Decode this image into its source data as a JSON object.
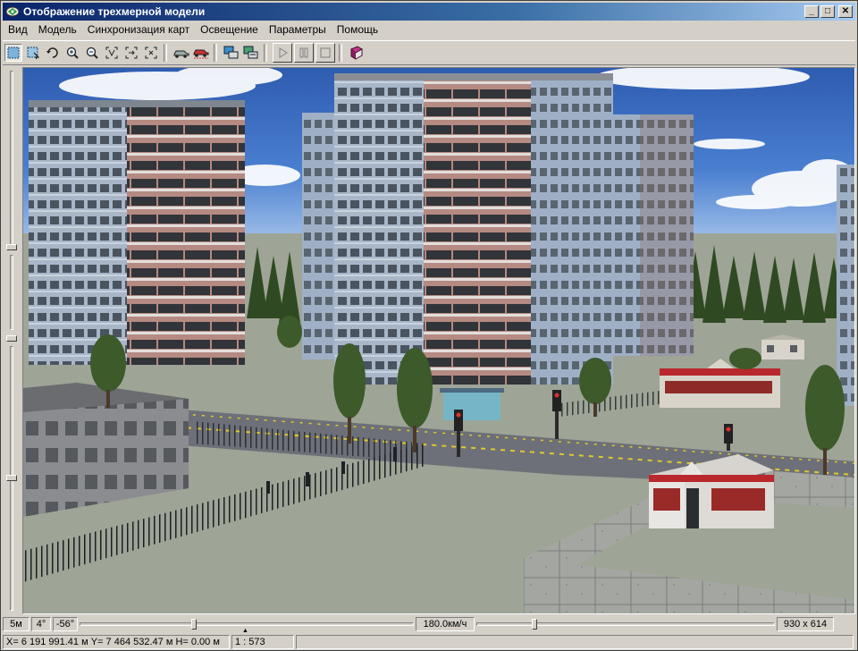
{
  "window": {
    "title": "Отображение трехмерной модели",
    "minimize_glyph": "_",
    "maximize_glyph": "□",
    "close_glyph": "✕"
  },
  "menu": {
    "items": [
      "Вид",
      "Модель",
      "Синхронизация карт",
      "Освещение",
      "Параметры",
      "Помощь"
    ]
  },
  "toolbar": {
    "buttons": [
      {
        "icon": "select-region-icon",
        "pressed": true
      },
      {
        "icon": "select-object-icon"
      },
      {
        "icon": "rotate-icon"
      },
      {
        "icon": "zoom-in-icon"
      },
      {
        "icon": "zoom-out-icon"
      },
      {
        "icon": "fit-view-icon"
      },
      {
        "icon": "move-view-icon"
      },
      {
        "icon": "zoom-window-icon"
      },
      {
        "icon": "car-icon"
      },
      {
        "icon": "car-route-icon"
      },
      {
        "icon": "map-link-icon"
      },
      {
        "icon": "map-sync-icon"
      },
      {
        "icon": "play-icon"
      },
      {
        "icon": "pause-icon"
      },
      {
        "icon": "stop-icon"
      },
      {
        "icon": "help-book-icon"
      }
    ]
  },
  "status": {
    "scale_step": "5м",
    "angle_step": "4°",
    "tilt": "-56°",
    "speed": "180.0км/ч",
    "view_size": "930 x 614",
    "coords": "X= 6 191 991.41 м  Y= 7 464 532.47 м  H= 0.00 м",
    "map_scale": "1 : 573",
    "slider1_level": 0.34,
    "slider2_level": 0.19
  },
  "colors": {
    "title_gradient_start": "#0a246a",
    "title_gradient_end": "#a6caf0",
    "chrome": "#d4d0c8",
    "sky": "#3f6fc4",
    "ground": "#9ea496",
    "building_panel": "#a9b8cc",
    "building_accent": "#b88a80",
    "kiosk_red": "#b8282c"
  }
}
